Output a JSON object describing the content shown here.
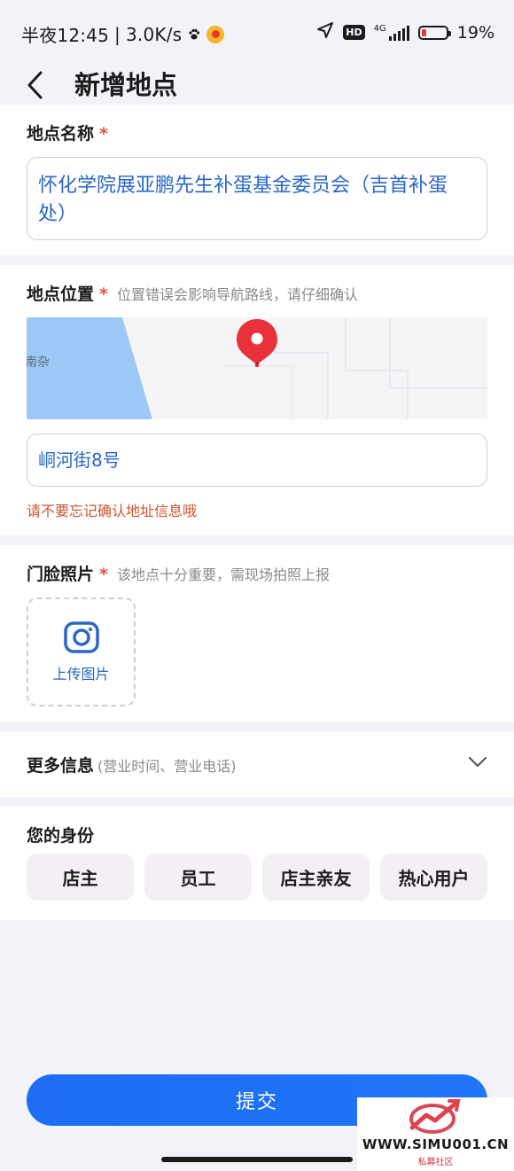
{
  "status_bar": {
    "time": "半夜12:45",
    "speed": "3.0K/s",
    "hd": "HD",
    "network": "4G",
    "battery_percent": "19%",
    "battery_level": 0.19
  },
  "header": {
    "title": "新增地点"
  },
  "name_section": {
    "label": "地点名称",
    "required_mark": "*",
    "value": "怀化学院展亚鹏先生补蛋基金委员会（吉首补蛋处）"
  },
  "location_section": {
    "label": "地点位置",
    "required_mark": "*",
    "hint": "位置错误会影响导航路线，请仔细确认",
    "map_label": "南杂",
    "address": "峒河街8号",
    "warning": "请不要忘记确认地址信息哦"
  },
  "photo_section": {
    "label": "门脸照片",
    "required_mark": "*",
    "hint": "该地点十分重要，需现场拍照上报",
    "upload_label": "上传图片"
  },
  "more_section": {
    "label": "更多信息",
    "hint": "(营业时间、营业电话)"
  },
  "identity_section": {
    "label": "您的身份",
    "options": [
      "店主",
      "员工",
      "店主亲友",
      "热心用户"
    ]
  },
  "submit_label": "提交",
  "watermark": {
    "text": "WWW.SIMU001.CN",
    "sub": "私募社区"
  },
  "colors": {
    "accent": "#1f6ff5",
    "link_text": "#2a67c6",
    "required": "#e0543a",
    "warning": "#d0552f",
    "pin": "#e8313a",
    "map_water": "#9dc9f7"
  }
}
